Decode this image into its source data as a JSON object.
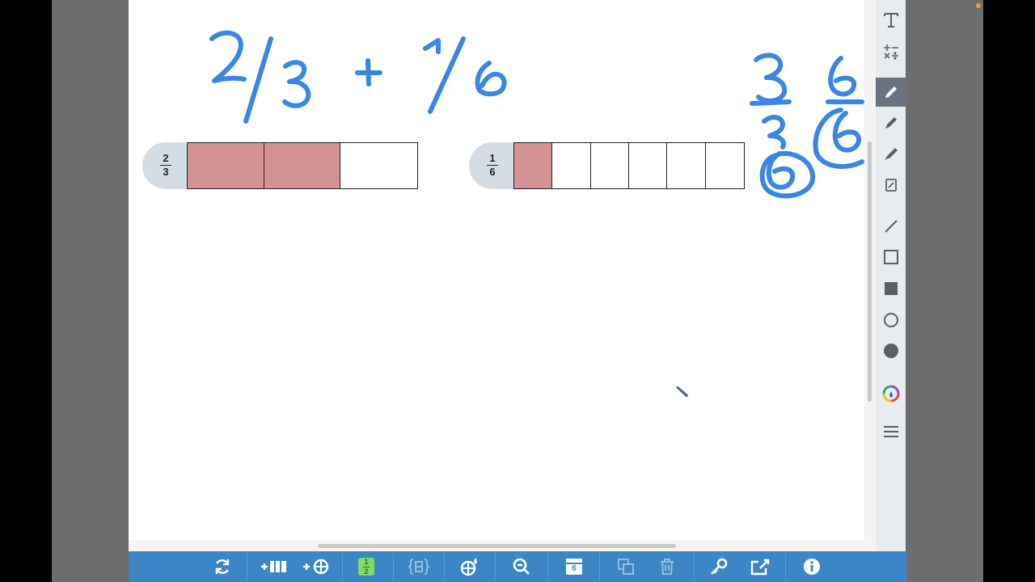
{
  "bars": [
    {
      "numerator": "2",
      "denominator": "3",
      "parts": 3,
      "shaded": 2
    },
    {
      "numerator": "1",
      "denominator": "6",
      "parts": 6,
      "shaded": 1
    }
  ],
  "colors": {
    "ink": "#3a86e3",
    "shade": "#d39294",
    "toolbar": "#3d86c6",
    "panel": "#e8ecef"
  },
  "right_tools": [
    "text-icon",
    "math-symbols-icon",
    "pen-icon",
    "marker-icon",
    "highlighter-icon",
    "eraser-icon",
    "line-icon",
    "rectangle-outline-icon",
    "rectangle-filled-icon",
    "circle-outline-icon",
    "circle-filled-icon",
    "color-picker-icon",
    "menu-icon"
  ],
  "bottom_tools": [
    "reset-icon",
    "add-bar-icon",
    "add-grid-icon",
    "fraction-label-icon",
    "braces-icon",
    "shape-color-icon",
    "zoom-out-icon",
    "calendar-icon",
    "duplicate-icon",
    "trash-icon",
    "key-icon",
    "share-icon",
    "info-icon"
  ],
  "bottom_fraction_icon": {
    "numerator": "1",
    "denominator": "2"
  },
  "bottom_calendar_icon_text": "6"
}
